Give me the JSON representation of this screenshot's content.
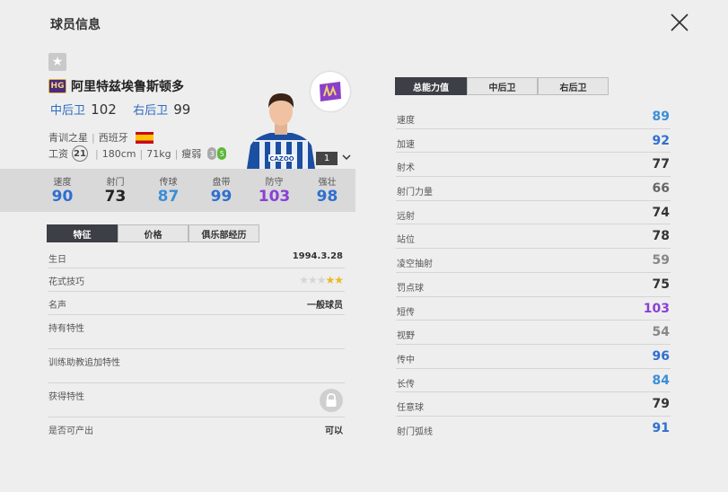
{
  "header": {
    "title": "球员信息"
  },
  "player": {
    "badge": "HG",
    "name": "阿里特兹埃鲁斯顿多",
    "positions": [
      {
        "pos": "中后卫",
        "ovr": "102"
      },
      {
        "pos": "右后卫",
        "ovr": "99"
      }
    ],
    "origin": "青训之星",
    "nation": "西班牙",
    "salary_label": "工资",
    "salary": "21",
    "height": "180cm",
    "weight": "71kg",
    "body": "瘦弱",
    "weak_foot_left": "3",
    "weak_foot_right": "5",
    "level": "1",
    "shirt_text": "CAZOO"
  },
  "stats": [
    {
      "label": "速度",
      "value": "90",
      "color": "#2f6fd0"
    },
    {
      "label": "射门",
      "value": "73",
      "color": "#222222"
    },
    {
      "label": "传球",
      "value": "87",
      "color": "#3a8fd8"
    },
    {
      "label": "盘带",
      "value": "99",
      "color": "#2f6fd0"
    },
    {
      "label": "防守",
      "value": "103",
      "color": "#8a3fd6"
    },
    {
      "label": "强壮",
      "value": "98",
      "color": "#2f6fd0"
    }
  ],
  "left_tabs": [
    "特征",
    "价格",
    "俱乐部经历"
  ],
  "info": {
    "birthday_label": "生日",
    "birthday": "1994.3.28",
    "skill_label": "花式技巧",
    "skill_stars": 2,
    "skill_stars_max": 5,
    "fame_label": "名声",
    "fame": "一般球员",
    "traits_label": "持有特性",
    "coach_traits_label": "训练助教追加特性",
    "acquired_traits_label": "获得特性",
    "producible_label": "是否可产出",
    "producible": "可以"
  },
  "right_tabs": [
    "总能力值",
    "中后卫",
    "右后卫"
  ],
  "attributes": [
    {
      "label": "速度",
      "value": "89",
      "color": "#3a8fd8"
    },
    {
      "label": "加速",
      "value": "92",
      "color": "#2f6fd0"
    },
    {
      "label": "射术",
      "value": "77",
      "color": "#333333"
    },
    {
      "label": "射门力量",
      "value": "66",
      "color": "#666666"
    },
    {
      "label": "远射",
      "value": "74",
      "color": "#333333"
    },
    {
      "label": "站位",
      "value": "78",
      "color": "#333333"
    },
    {
      "label": "凌空抽射",
      "value": "59",
      "color": "#888888"
    },
    {
      "label": "罚点球",
      "value": "75",
      "color": "#333333"
    },
    {
      "label": "短传",
      "value": "103",
      "color": "#8a3fd6"
    },
    {
      "label": "视野",
      "value": "54",
      "color": "#888888"
    },
    {
      "label": "传中",
      "value": "96",
      "color": "#2f6fd0"
    },
    {
      "label": "长传",
      "value": "84",
      "color": "#3a8fd8"
    },
    {
      "label": "任意球",
      "value": "79",
      "color": "#333333"
    },
    {
      "label": "射门弧线",
      "value": "91",
      "color": "#2f6fd0"
    }
  ]
}
